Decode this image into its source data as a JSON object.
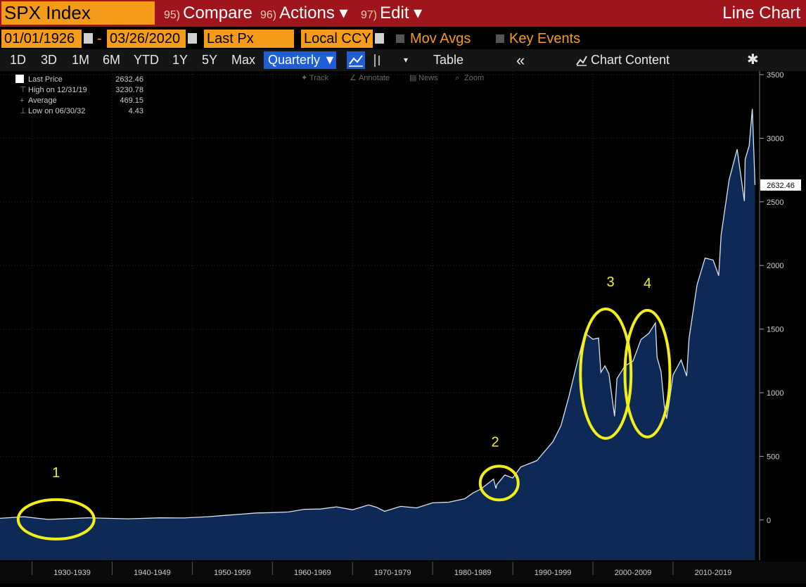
{
  "toolbar": {
    "ticker": "SPX Index",
    "compare_num": "95)",
    "compare_label": "Compare",
    "actions_num": "96)",
    "actions_label": "Actions ▾",
    "edit_num": "97)",
    "edit_label": "Edit ▾",
    "view_title": "Line Chart"
  },
  "range": {
    "start_date": "01/01/1926",
    "separator": "-",
    "end_date": "03/26/2020",
    "field": "Last Px",
    "currency": "Local CCY",
    "mov_avgs": "Mov Avgs",
    "key_events": "Key Events"
  },
  "periods": [
    "1D",
    "3D",
    "1M",
    "6M",
    "YTD",
    "1Y",
    "5Y",
    "Max"
  ],
  "frequency": "Quarterly ▼",
  "controls": {
    "table_label": "Table",
    "collapse_label": "«",
    "chart_content_label": "Chart Content",
    "settings_icon": "gear-icon"
  },
  "chart_tools": [
    "Track",
    "Annotate",
    "News",
    "Zoom"
  ],
  "legend": [
    {
      "label": "Last Price",
      "value": "2632.46"
    },
    {
      "label": "High on 12/31/19",
      "value": "3230.78"
    },
    {
      "label": "Average",
      "value": "469.15"
    },
    {
      "label": "Low on 06/30/32",
      "value": "4.43"
    }
  ],
  "annotations": [
    "1",
    "2",
    "3",
    "4"
  ],
  "last_price_tag": "2632.46",
  "colors": {
    "accent_orange": "#f59b1a",
    "header_red": "#a0141c",
    "area_fill": "#0c2a55",
    "line": "#d8e4f2",
    "circle": "#f2ee1c"
  },
  "chart_data": {
    "type": "area",
    "ylim": [
      -300,
      3500
    ],
    "y_ticks": [
      0,
      500,
      1000,
      1500,
      2000,
      2500,
      3000,
      3500
    ],
    "x_tick_labels": [
      "1930-1939",
      "1940-1949",
      "1950-1959",
      "1960-1969",
      "1970-1979",
      "1980-1989",
      "1990-1999",
      "2000-2009",
      "2010-2019"
    ],
    "series": [
      {
        "x": [
          1926,
          1929,
          1932,
          1937,
          1942,
          1946,
          1949,
          1952,
          1954,
          1956,
          1958,
          1960,
          1962,
          1964,
          1966,
          1968,
          1970,
          1972,
          1973,
          1974,
          1976,
          1978,
          1980,
          1982,
          1984,
          1985,
          1986,
          1987.6,
          1987.9,
          1988,
          1989,
          1990,
          1991,
          1993,
          1995,
          1996,
          1997,
          1998,
          1999,
          2000,
          2000.7,
          2001,
          2001.5,
          2002,
          2002.7,
          2003,
          2004,
          2005,
          2006,
          2007,
          2007.8,
          2008,
          2008.5,
          2008.9,
          2009.2,
          2009.5,
          2010,
          2011,
          2011.7,
          2012,
          2013,
          2014,
          2015,
          2015.7,
          2016,
          2017,
          2018,
          2018.9,
          2019,
          2019.5,
          2019.9,
          2020.23
        ],
        "y": [
          13,
          25,
          4.43,
          17,
          9,
          17,
          16,
          26,
          36,
          45,
          55,
          58,
          63,
          84,
          86,
          103,
          80,
          118,
          100,
          68,
          107,
          95,
          135,
          140,
          167,
          211,
          242,
          321,
          247,
          277,
          353,
          330,
          417,
          466,
          615,
          740,
          970,
          1229,
          1469,
          1420,
          1430,
          1160,
          1211,
          1147,
          815,
          1111,
          1211,
          1248,
          1418,
          1468,
          1549,
          1280,
          1166,
          903,
          797,
          919,
          1140,
          1257,
          1131,
          1426,
          1848,
          2058,
          2043,
          1920,
          2238,
          2673,
          2913,
          2506,
          2834,
          2941,
          3230.78,
          2632.46
        ]
      }
    ]
  }
}
